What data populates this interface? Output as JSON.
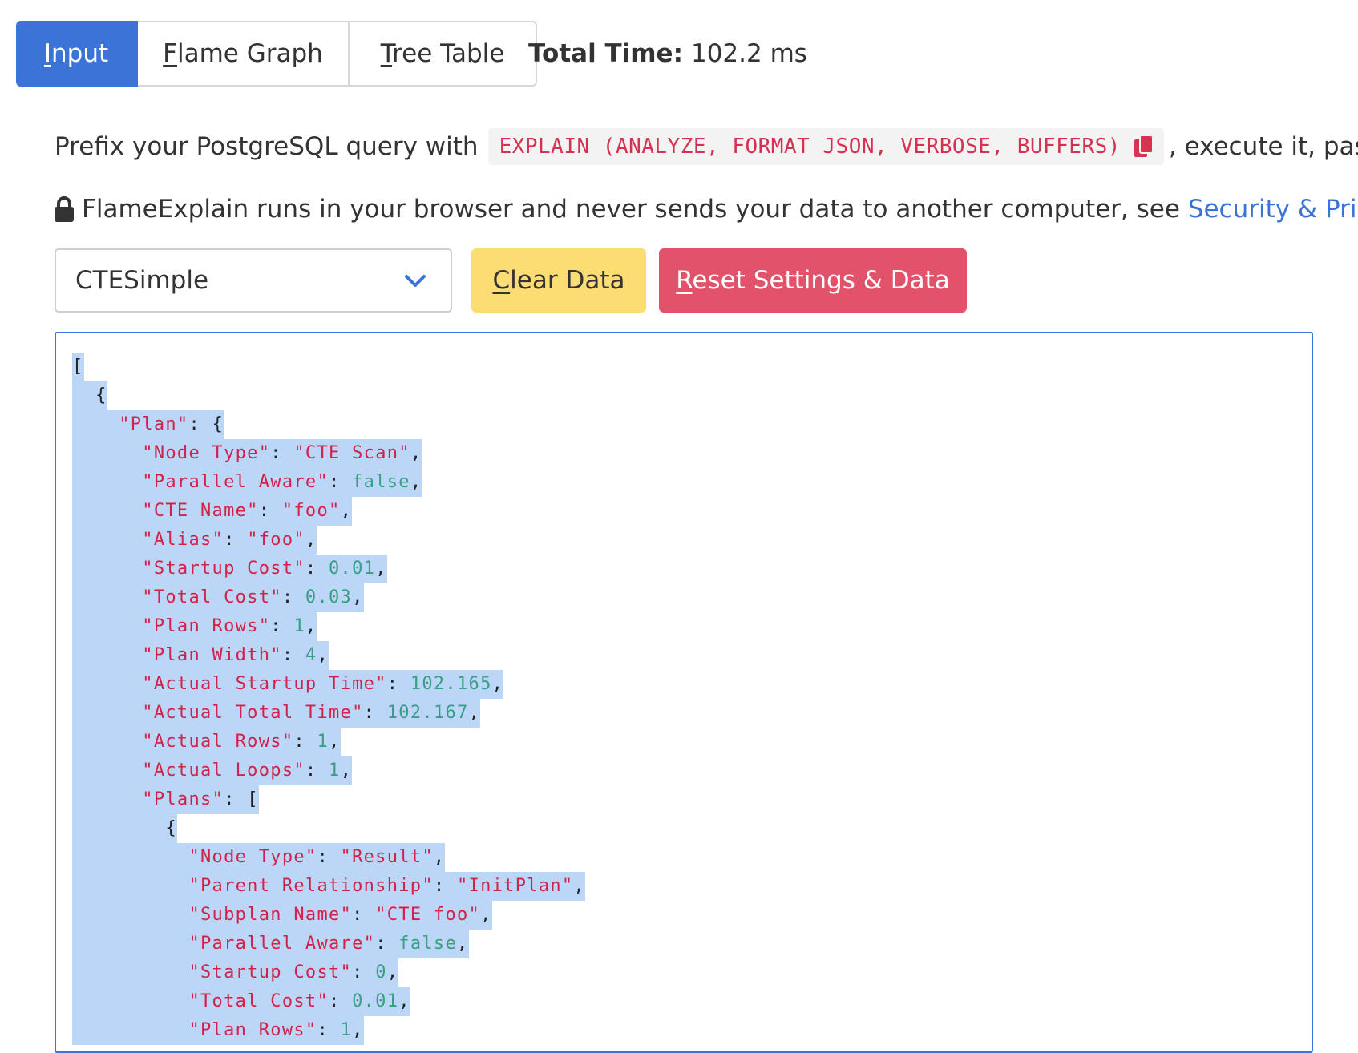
{
  "tabs": [
    {
      "underline_char": "I",
      "rest": "nput"
    },
    {
      "underline_char": "F",
      "rest": "lame Graph"
    },
    {
      "underline_char": "T",
      "rest": "ree Table"
    }
  ],
  "total_time": {
    "label": "Total Time:",
    "value": "102.2 ms"
  },
  "instructions": {
    "prefix": "Prefix your PostgreSQL query with",
    "code": "EXPLAIN (ANALYZE, FORMAT JSON, VERBOSE, BUFFERS)",
    "suffix": ", execute it, paste"
  },
  "privacy": {
    "text": "FlameExplain runs in your browser and never sends your data to another computer, see",
    "link": "Security & Privacy",
    "trailing": "."
  },
  "example_select": {
    "value": "CTESimple"
  },
  "buttons": {
    "clear": {
      "underline_char": "C",
      "rest": "lear Data"
    },
    "reset": {
      "underline_char": "R",
      "rest": "eset Settings & Data"
    }
  },
  "colors": {
    "accent": "#3b73d6",
    "clear_bg": "#fbdd74",
    "reset_bg": "#e2526a",
    "selection": "#bcd6f8",
    "json_key": "#d1234a",
    "json_value": "#3a9e84"
  },
  "code_lines": [
    {
      "indent": "",
      "key": "",
      "value": "[",
      "kind": "punct",
      "trail": ""
    },
    {
      "indent": "  ",
      "key": "",
      "value": "{",
      "kind": "punct",
      "trail": ""
    },
    {
      "indent": "    ",
      "key": "\"Plan\"",
      "value": "{",
      "kind": "punct",
      "trail": ""
    },
    {
      "indent": "      ",
      "key": "\"Node Type\"",
      "value": "\"CTE Scan\"",
      "kind": "string",
      "trail": ","
    },
    {
      "indent": "      ",
      "key": "\"Parallel Aware\"",
      "value": "false",
      "kind": "number",
      "trail": ","
    },
    {
      "indent": "      ",
      "key": "\"CTE Name\"",
      "value": "\"foo\"",
      "kind": "string",
      "trail": ","
    },
    {
      "indent": "      ",
      "key": "\"Alias\"",
      "value": "\"foo\"",
      "kind": "string",
      "trail": ","
    },
    {
      "indent": "      ",
      "key": "\"Startup Cost\"",
      "value": "0.01",
      "kind": "number",
      "trail": ","
    },
    {
      "indent": "      ",
      "key": "\"Total Cost\"",
      "value": "0.03",
      "kind": "number",
      "trail": ","
    },
    {
      "indent": "      ",
      "key": "\"Plan Rows\"",
      "value": "1",
      "kind": "number",
      "trail": ","
    },
    {
      "indent": "      ",
      "key": "\"Plan Width\"",
      "value": "4",
      "kind": "number",
      "trail": ","
    },
    {
      "indent": "      ",
      "key": "\"Actual Startup Time\"",
      "value": "102.165",
      "kind": "number",
      "trail": ","
    },
    {
      "indent": "      ",
      "key": "\"Actual Total Time\"",
      "value": "102.167",
      "kind": "number",
      "trail": ","
    },
    {
      "indent": "      ",
      "key": "\"Actual Rows\"",
      "value": "1",
      "kind": "number",
      "trail": ","
    },
    {
      "indent": "      ",
      "key": "\"Actual Loops\"",
      "value": "1",
      "kind": "number",
      "trail": ","
    },
    {
      "indent": "      ",
      "key": "\"Plans\"",
      "value": "[",
      "kind": "punct",
      "trail": ""
    },
    {
      "indent": "        ",
      "key": "",
      "value": "{",
      "kind": "punct",
      "trail": ""
    },
    {
      "indent": "          ",
      "key": "\"Node Type\"",
      "value": "\"Result\"",
      "kind": "string",
      "trail": ","
    },
    {
      "indent": "          ",
      "key": "\"Parent Relationship\"",
      "value": "\"InitPlan\"",
      "kind": "string",
      "trail": ","
    },
    {
      "indent": "          ",
      "key": "\"Subplan Name\"",
      "value": "\"CTE foo\"",
      "kind": "string",
      "trail": ","
    },
    {
      "indent": "          ",
      "key": "\"Parallel Aware\"",
      "value": "false",
      "kind": "number",
      "trail": ","
    },
    {
      "indent": "          ",
      "key": "\"Startup Cost\"",
      "value": "0",
      "kind": "number",
      "trail": ","
    },
    {
      "indent": "          ",
      "key": "\"Total Cost\"",
      "value": "0.01",
      "kind": "number",
      "trail": ","
    },
    {
      "indent": "          ",
      "key": "\"Plan Rows\"",
      "value": "1",
      "kind": "number",
      "trail": ","
    }
  ]
}
